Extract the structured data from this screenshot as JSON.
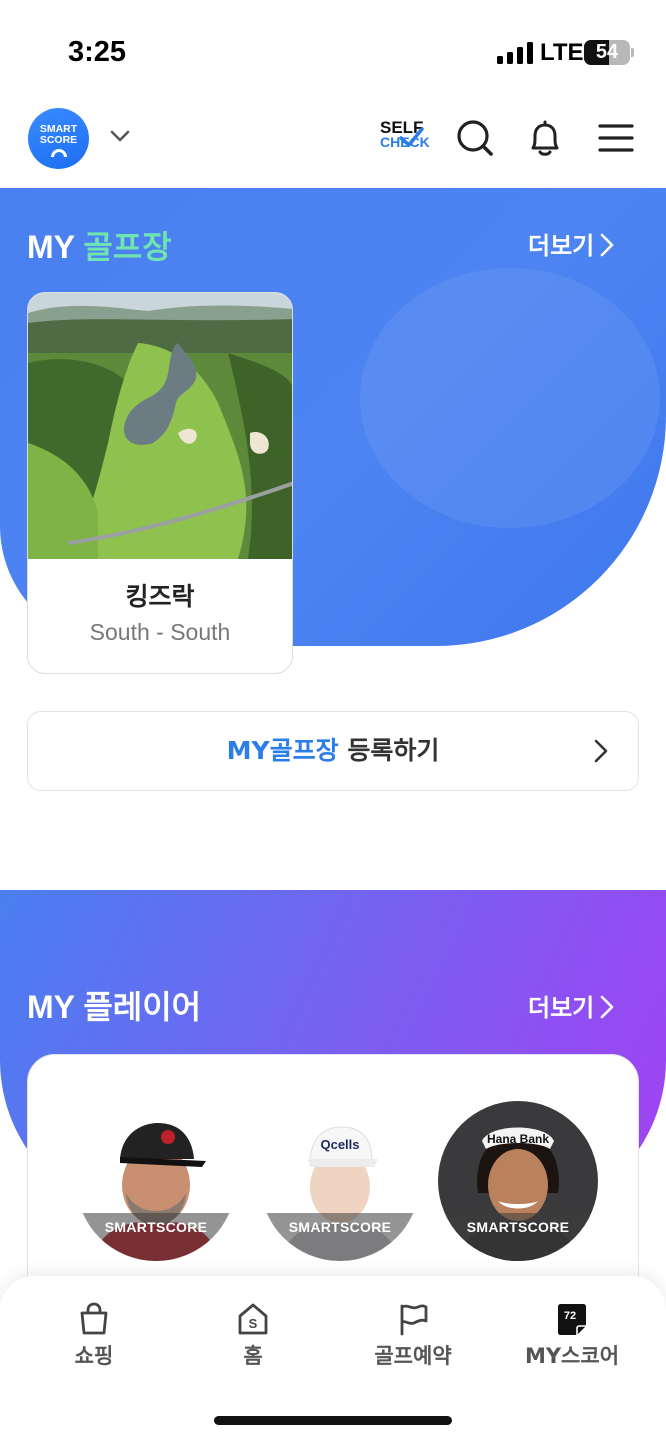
{
  "status_bar": {
    "time": "3:25",
    "network": "LTE",
    "battery_percent": "54",
    "battery_level": 0.54
  },
  "header": {
    "logo_line1": "SMART",
    "logo_line2": "SCORE",
    "self_check_line1": "SELF",
    "self_check_line2": "CHECK",
    "icons": [
      "chevron-down-icon",
      "search-icon",
      "bell-icon",
      "menu-icon"
    ]
  },
  "my_golf": {
    "title_prefix": "MY",
    "title_accent": "골프장",
    "more_label": "더보기",
    "courses": [
      {
        "name": "킹즈락",
        "sub": "South - South"
      }
    ],
    "register_accent": "MY골프장",
    "register_label": "등록하기"
  },
  "my_player": {
    "title": "MY 플레이어",
    "more_label": "더보기",
    "players": [
      {
        "badge": "SMARTSCORE",
        "cap_text": ""
      },
      {
        "badge": "SMARTSCORE",
        "cap_text": "Qcells"
      },
      {
        "badge": "SMARTSCORE",
        "cap_text": "Hana Bank"
      }
    ]
  },
  "bottom_nav": {
    "items": [
      {
        "label": "쇼핑",
        "icon": "shopping-bag-icon"
      },
      {
        "label": "홈",
        "icon": "home-icon"
      },
      {
        "label": "골프예약",
        "icon": "flag-icon"
      },
      {
        "label": "MY스코어",
        "icon": "scorecard-icon",
        "badge": "72"
      }
    ]
  },
  "colors": {
    "primary_blue": "#2b7de9",
    "golf_section_bg": "#4a7ff0",
    "accent_green": "#6fe3b0",
    "player_gradient_end": "#a340f2"
  }
}
